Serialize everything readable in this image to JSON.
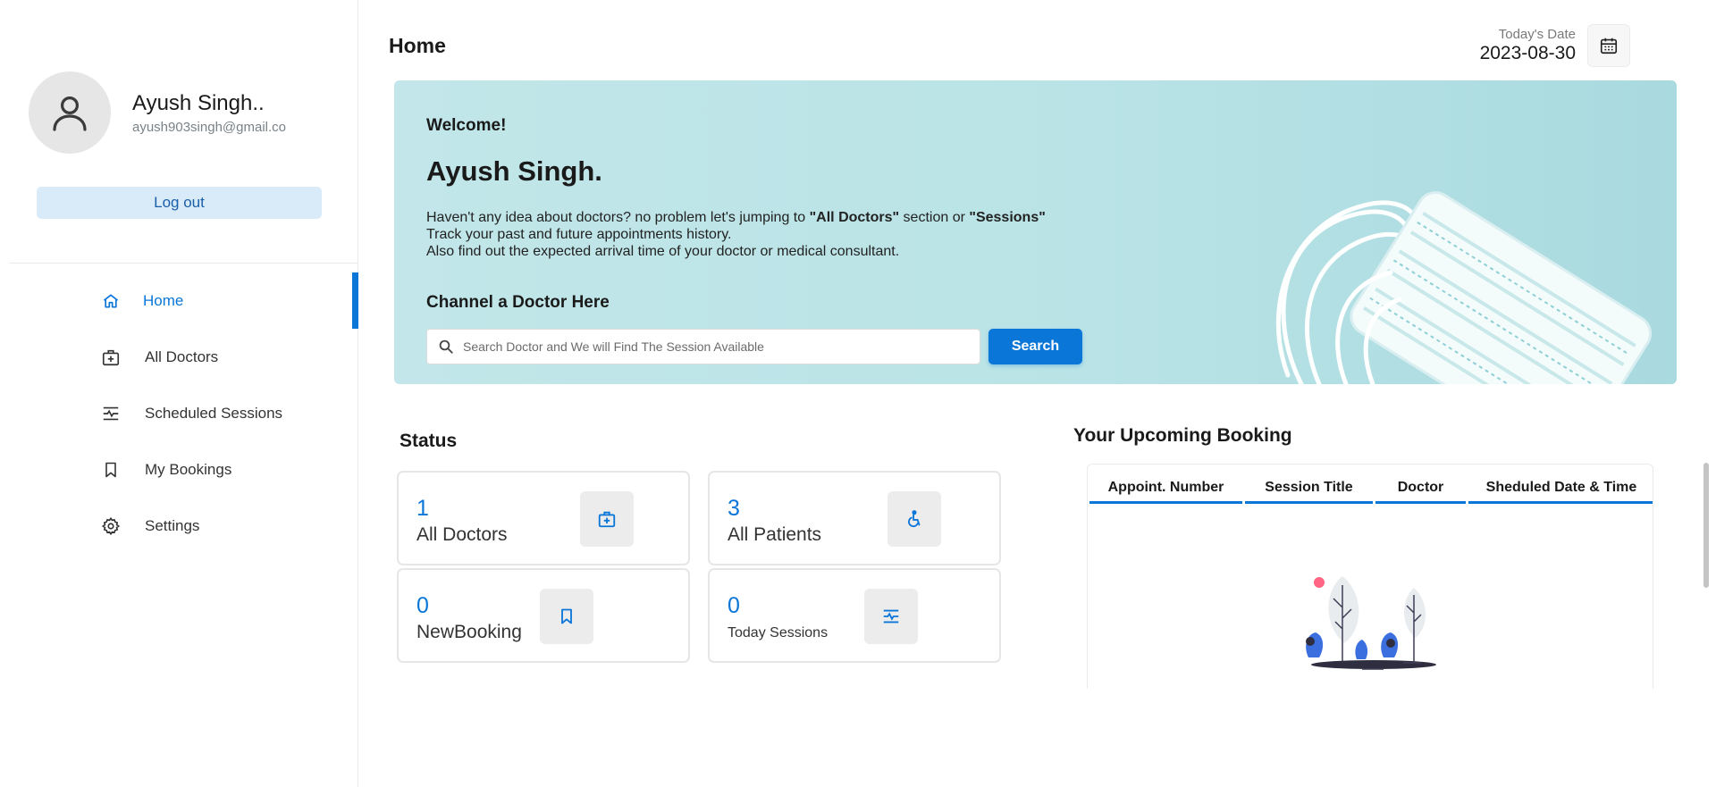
{
  "user": {
    "name": "Ayush Singh..",
    "email": "ayush903singh@gmail.co",
    "logout_label": "Log out"
  },
  "nav": {
    "items": [
      {
        "label": "Home",
        "icon": "home-icon",
        "active": true
      },
      {
        "label": "All Doctors",
        "icon": "doctor-bag-icon",
        "active": false
      },
      {
        "label": "Scheduled Sessions",
        "icon": "session-icon",
        "active": false
      },
      {
        "label": "My Bookings",
        "icon": "bookmark-icon",
        "active": false
      },
      {
        "label": "Settings",
        "icon": "gear-icon",
        "active": false
      }
    ]
  },
  "header": {
    "title": "Home",
    "date_label": "Today's Date",
    "date_value": "2023-08-30"
  },
  "banner": {
    "welcome": "Welcome!",
    "name": "Ayush Singh.",
    "line1_a": "Haven't any idea about doctors? no problem let's jumping to ",
    "line1_b": "\"All Doctors\"",
    "line1_c": " section or ",
    "line1_d": "\"Sessions\"",
    "line2": "Track your past and future appointments history.",
    "line3": "Also find out the expected arrival time of your doctor or medical consultant.",
    "channel_title": "Channel a Doctor Here",
    "search_placeholder": "Search Doctor and We will Find The Session Available",
    "search_label": "Search"
  },
  "status": {
    "title": "Status",
    "cards": [
      {
        "value": "1",
        "label": "All Doctors",
        "icon": "doctor-bag-icon"
      },
      {
        "value": "3",
        "label": "All Patients",
        "icon": "wheelchair-icon"
      },
      {
        "value": "0",
        "label": "NewBooking",
        "icon": "bookmark-icon"
      },
      {
        "value": "0",
        "label": "Today Sessions",
        "icon": "session-icon"
      }
    ]
  },
  "upcoming": {
    "title": "Your Upcoming Booking",
    "columns": [
      "Appoint. Number",
      "Session Title",
      "Doctor",
      "Sheduled Date & Time"
    ]
  },
  "colors": {
    "accent": "#0a76d8",
    "banner": "#b9e3e6",
    "logout_bg": "#d9eaf8"
  }
}
